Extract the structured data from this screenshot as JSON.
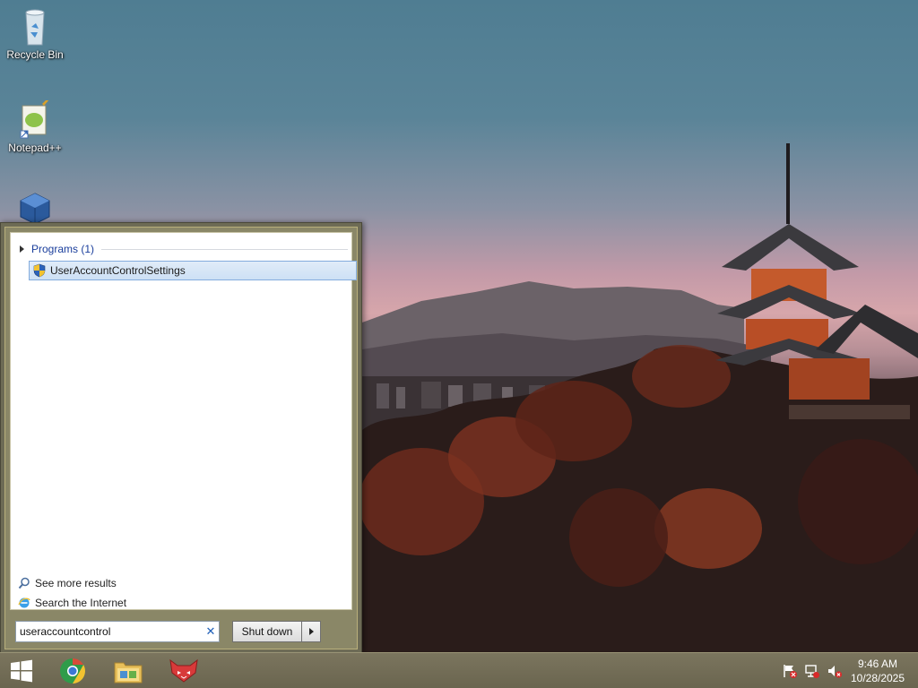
{
  "desktop": {
    "icons": [
      {
        "label": "Recycle Bin",
        "icon": "recycle-bin-icon"
      },
      {
        "label": "Notepad++",
        "icon": "notepad-plus-plus-icon"
      },
      {
        "label": "",
        "icon": "virtualbox-icon"
      }
    ]
  },
  "start_menu": {
    "group_header": "Programs (1)",
    "results": [
      {
        "label": "UserAccountControlSettings",
        "icon": "uac-shield-icon"
      }
    ],
    "see_more": "See more results",
    "search_internet": "Search the Internet",
    "search_value": "useraccountcontrol",
    "shutdown_label": "Shut down"
  },
  "taskbar": {
    "start_icon": "windows-logo-icon",
    "pinned": [
      {
        "name": "chrome",
        "icon": "chrome-icon"
      },
      {
        "name": "file-explorer",
        "icon": "file-explorer-icon"
      },
      {
        "name": "app",
        "icon": "red-fox-app-icon"
      }
    ],
    "tray": [
      "action-center-flag-icon",
      "network-icon",
      "volume-muted-icon"
    ],
    "time": "9:46 AM",
    "date": "10/28/2025"
  },
  "colors": {
    "taskbar": "#6d6850",
    "start_frame": "#8a8767",
    "selection": "#cde0f5",
    "link": "#1a3e9c"
  }
}
